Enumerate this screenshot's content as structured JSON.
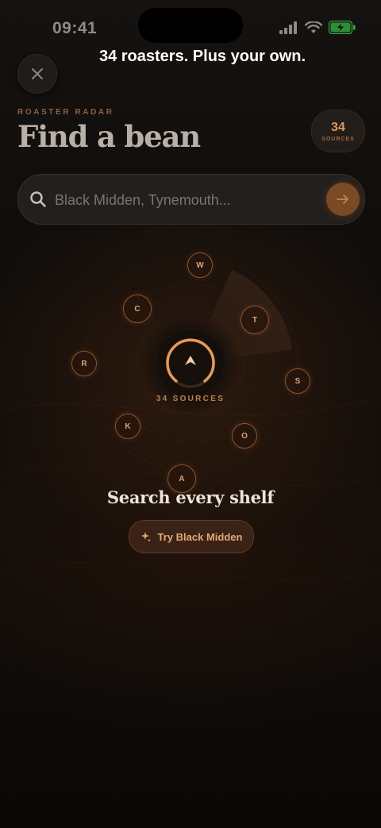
{
  "status_bar": {
    "time": "09:41"
  },
  "banner": "34 roasters. Plus your own.",
  "header": {
    "eyebrow": "ROASTER RADAR",
    "title": "Find a bean",
    "count": "34",
    "count_label": "SOURCES"
  },
  "search": {
    "placeholder": "Black Midden, Tynemouth...",
    "value": ""
  },
  "radar": {
    "sources_label": "34 SOURCES",
    "nodes": [
      "W",
      "T",
      "S",
      "O",
      "A",
      "K",
      "R",
      "C"
    ]
  },
  "empty_state": {
    "headline": "Search every shelf",
    "cta_label": "Try Black Midden"
  },
  "colors": {
    "accent": "#d79a5f",
    "background": "#0d0a08",
    "battery": "#3fae48"
  },
  "icons": [
    "close-icon",
    "search-icon",
    "arrow-right-icon",
    "sparkle-icon",
    "chevron-up-icon",
    "signal-icon",
    "wifi-icon",
    "battery-icon"
  ]
}
